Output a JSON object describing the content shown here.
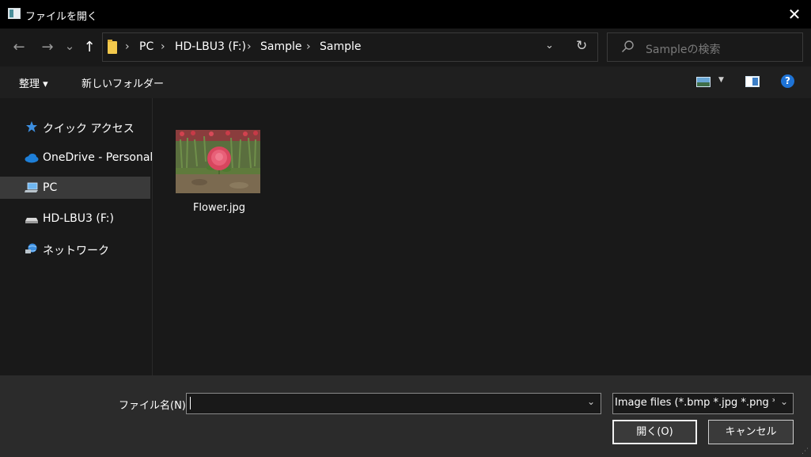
{
  "window": {
    "title": "ファイルを開く",
    "close_glyph": "✕"
  },
  "nav": {
    "back": "←",
    "forward": "→",
    "recent": "⌄",
    "up": "↑",
    "breadcrumb": [
      "PC",
      "HD-LBU3 (F:)",
      "Sample",
      "Sample"
    ],
    "sep": "›",
    "dropdown": "⌄",
    "refresh": "↻"
  },
  "search": {
    "placeholder": "Sampleの検索"
  },
  "toolbar": {
    "organize": "整理 ▾",
    "new_folder": "新しいフォルダー",
    "view_drop": "▼",
    "help": "?"
  },
  "sidebar": {
    "items": [
      {
        "label": "クイック アクセス",
        "icon": "star-icon"
      },
      {
        "label": "OneDrive - Personal",
        "icon": "cloud-icon"
      },
      {
        "label": "PC",
        "icon": "pc-icon",
        "selected": true
      },
      {
        "label": "HD-LBU3 (F:)",
        "icon": "drive-icon"
      },
      {
        "label": "ネットワーク",
        "icon": "network-icon"
      }
    ]
  },
  "files": [
    {
      "name": "Flower.jpg",
      "type": "image"
    }
  ],
  "bottom": {
    "filename_label": "ファイル名(N):",
    "filename_value": "",
    "filename_drop": "⌄",
    "filter": "Image files (*.bmp *.jpg *.png *",
    "filter_drop": "⌄",
    "open_label": "開く(O)",
    "cancel_label": "キャンセル",
    "grip": "⋰"
  },
  "colors": {
    "accent": "#1e73d6",
    "selected": "#3a3a3a",
    "bg": "#191919"
  }
}
